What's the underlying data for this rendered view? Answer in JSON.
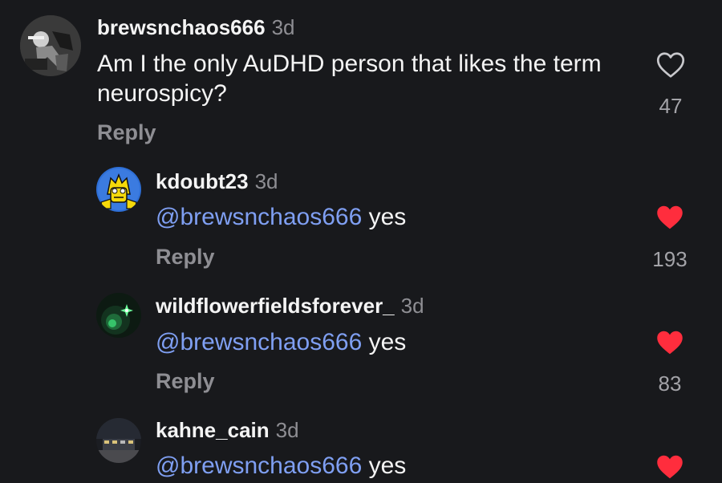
{
  "comments": [
    {
      "username": "brewsnchaos666",
      "time": "3d",
      "mention": "",
      "text": "Am I the only AuDHD person that likes the term neurospicy?",
      "reply_label": "Reply",
      "likes": "47",
      "liked": false,
      "avatar_icon": "dark-photo-avatar"
    },
    {
      "username": "kdoubt23",
      "time": "3d",
      "mention": "@brewsnchaos666",
      "text": "yes",
      "reply_label": "Reply",
      "likes": "193",
      "liked": true,
      "avatar_icon": "cartoon-character-avatar"
    },
    {
      "username": "wildflowerfieldsforever_",
      "time": "3d",
      "mention": "@brewsnchaos666",
      "text": "yes",
      "reply_label": "Reply",
      "likes": "83",
      "liked": true,
      "avatar_icon": "green-sparkle-avatar"
    },
    {
      "username": "kahne_cain",
      "time": "3d",
      "mention": "@brewsnchaos666",
      "text": "yes",
      "reply_label": "",
      "likes": "",
      "liked": true,
      "avatar_icon": "night-scene-avatar"
    }
  ],
  "colors": {
    "background": "#18191c",
    "mention": "#7f9ff2",
    "liked_heart": "#ff2d3d",
    "muted_text": "#8e8e93"
  }
}
